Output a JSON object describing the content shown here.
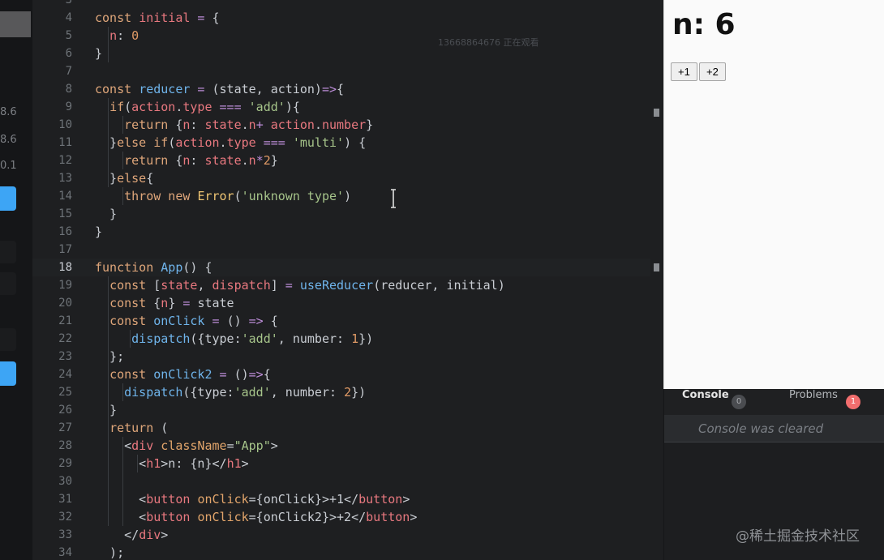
{
  "sidebar": {
    "nums": [
      "8.6",
      "8.6",
      "0.1"
    ]
  },
  "editor": {
    "watermark": "13668864676 正在观看",
    "lines": [
      {
        "n": "3",
        "t": []
      },
      {
        "n": "4",
        "t": [
          [
            "kw",
            "const "
          ],
          [
            "var",
            "initial"
          ],
          [
            "op",
            " = "
          ],
          [
            "txt",
            "{"
          ]
        ]
      },
      {
        "n": "5",
        "t": [
          [
            "txt",
            "  "
          ],
          [
            "prop",
            "n"
          ],
          [
            "txt",
            ": "
          ],
          [
            "num",
            "0"
          ]
        ]
      },
      {
        "n": "6",
        "t": [
          [
            "txt",
            "}"
          ]
        ]
      },
      {
        "n": "7",
        "t": []
      },
      {
        "n": "8",
        "t": [
          [
            "kw",
            "const "
          ],
          [
            "fn",
            "reducer"
          ],
          [
            "op",
            " = "
          ],
          [
            "txt",
            "(state, action)"
          ],
          [
            "op",
            "=>"
          ],
          [
            "txt",
            "{"
          ]
        ]
      },
      {
        "n": "9",
        "t": [
          [
            "txt",
            "  "
          ],
          [
            "kw",
            "if"
          ],
          [
            "txt",
            "("
          ],
          [
            "var",
            "action"
          ],
          [
            "txt",
            "."
          ],
          [
            "prop",
            "type"
          ],
          [
            "op",
            " === "
          ],
          [
            "str",
            "'add'"
          ],
          [
            "txt",
            "){"
          ]
        ]
      },
      {
        "n": "10",
        "t": [
          [
            "txt",
            "    "
          ],
          [
            "kw",
            "return "
          ],
          [
            "txt",
            "{"
          ],
          [
            "prop",
            "n"
          ],
          [
            "txt",
            ": "
          ],
          [
            "var",
            "state"
          ],
          [
            "txt",
            "."
          ],
          [
            "prop",
            "n"
          ],
          [
            "op",
            "+ "
          ],
          [
            "var",
            "action"
          ],
          [
            "txt",
            "."
          ],
          [
            "prop",
            "number"
          ],
          [
            "txt",
            "}"
          ]
        ]
      },
      {
        "n": "11",
        "t": [
          [
            "txt",
            "  }"
          ],
          [
            "kw",
            "else if"
          ],
          [
            "txt",
            "("
          ],
          [
            "var",
            "action"
          ],
          [
            "txt",
            "."
          ],
          [
            "prop",
            "type"
          ],
          [
            "op",
            " === "
          ],
          [
            "str",
            "'multi'"
          ],
          [
            "txt",
            ") {"
          ]
        ]
      },
      {
        "n": "12",
        "t": [
          [
            "txt",
            "    "
          ],
          [
            "kw",
            "return "
          ],
          [
            "txt",
            "{"
          ],
          [
            "prop",
            "n"
          ],
          [
            "txt",
            ": "
          ],
          [
            "var",
            "state"
          ],
          [
            "txt",
            "."
          ],
          [
            "prop",
            "n"
          ],
          [
            "op",
            "*"
          ],
          [
            "num",
            "2"
          ],
          [
            "txt",
            "}"
          ]
        ]
      },
      {
        "n": "13",
        "t": [
          [
            "txt",
            "  }"
          ],
          [
            "kw",
            "else"
          ],
          [
            "txt",
            "{"
          ]
        ]
      },
      {
        "n": "14",
        "t": [
          [
            "txt",
            "    "
          ],
          [
            "kw",
            "throw new "
          ],
          [
            "cls",
            "Error"
          ],
          [
            "txt",
            "("
          ],
          [
            "str",
            "'unknown type'"
          ],
          [
            "txt",
            ")"
          ]
        ]
      },
      {
        "n": "15",
        "t": [
          [
            "txt",
            "  }"
          ]
        ]
      },
      {
        "n": "16",
        "t": [
          [
            "txt",
            "}"
          ]
        ]
      },
      {
        "n": "17",
        "t": []
      },
      {
        "n": "18",
        "t": [
          [
            "kw",
            "function "
          ],
          [
            "fn",
            "App"
          ],
          [
            "txt",
            "() {"
          ]
        ],
        "active": true
      },
      {
        "n": "19",
        "t": [
          [
            "txt",
            "  "
          ],
          [
            "kw",
            "const "
          ],
          [
            "txt",
            "["
          ],
          [
            "var",
            "state"
          ],
          [
            "txt",
            ", "
          ],
          [
            "var",
            "dispatch"
          ],
          [
            "txt",
            "]"
          ],
          [
            "op",
            " = "
          ],
          [
            "fn",
            "useReducer"
          ],
          [
            "txt",
            "(reducer, initial)"
          ]
        ]
      },
      {
        "n": "20",
        "t": [
          [
            "txt",
            "  "
          ],
          [
            "kw",
            "const "
          ],
          [
            "txt",
            "{"
          ],
          [
            "var",
            "n"
          ],
          [
            "txt",
            "}"
          ],
          [
            "op",
            " = "
          ],
          [
            "txt",
            "state"
          ]
        ]
      },
      {
        "n": "21",
        "t": [
          [
            "txt",
            "  "
          ],
          [
            "kw",
            "const "
          ],
          [
            "fn",
            "onClick"
          ],
          [
            "op",
            " = "
          ],
          [
            "txt",
            "() "
          ],
          [
            "op",
            "=>"
          ],
          [
            "txt",
            " {"
          ]
        ]
      },
      {
        "n": "22",
        "t": [
          [
            "txt",
            "     "
          ],
          [
            "fn",
            "dispatch"
          ],
          [
            "txt",
            "({type:"
          ],
          [
            "str",
            "'add'"
          ],
          [
            "txt",
            ", number: "
          ],
          [
            "num",
            "1"
          ],
          [
            "txt",
            "})"
          ]
        ]
      },
      {
        "n": "23",
        "t": [
          [
            "txt",
            "  };"
          ]
        ]
      },
      {
        "n": "24",
        "t": [
          [
            "txt",
            "  "
          ],
          [
            "kw",
            "const "
          ],
          [
            "fn",
            "onClick2"
          ],
          [
            "op",
            " = "
          ],
          [
            "txt",
            "()"
          ],
          [
            "op",
            "=>"
          ],
          [
            "txt",
            "{"
          ]
        ]
      },
      {
        "n": "25",
        "t": [
          [
            "txt",
            "    "
          ],
          [
            "fn",
            "dispatch"
          ],
          [
            "txt",
            "({type:"
          ],
          [
            "str",
            "'add'"
          ],
          [
            "txt",
            ", number: "
          ],
          [
            "num",
            "2"
          ],
          [
            "txt",
            "})"
          ]
        ]
      },
      {
        "n": "26",
        "t": [
          [
            "txt",
            "  }"
          ]
        ]
      },
      {
        "n": "27",
        "t": [
          [
            "txt",
            "  "
          ],
          [
            "kw",
            "return "
          ],
          [
            "txt",
            "("
          ]
        ]
      },
      {
        "n": "28",
        "t": [
          [
            "txt",
            "    <"
          ],
          [
            "tag",
            "div "
          ],
          [
            "attr",
            "className"
          ],
          [
            "txt",
            "="
          ],
          [
            "str",
            "\"App\""
          ],
          [
            "txt",
            ">"
          ]
        ]
      },
      {
        "n": "29",
        "t": [
          [
            "txt",
            "      <"
          ],
          [
            "tag",
            "h1"
          ],
          [
            "txt",
            ">n: {n}</"
          ],
          [
            "tag",
            "h1"
          ],
          [
            "txt",
            ">"
          ]
        ]
      },
      {
        "n": "30",
        "t": []
      },
      {
        "n": "31",
        "t": [
          [
            "txt",
            "      <"
          ],
          [
            "tag",
            "button "
          ],
          [
            "attr",
            "onClick"
          ],
          [
            "txt",
            "={onClick}>+1</"
          ],
          [
            "tag",
            "button"
          ],
          [
            "txt",
            ">"
          ]
        ]
      },
      {
        "n": "32",
        "t": [
          [
            "txt",
            "      <"
          ],
          [
            "tag",
            "button "
          ],
          [
            "attr",
            "onClick"
          ],
          [
            "txt",
            "={onClick2}>+2</"
          ],
          [
            "tag",
            "button"
          ],
          [
            "txt",
            ">"
          ]
        ]
      },
      {
        "n": "33",
        "t": [
          [
            "txt",
            "    </"
          ],
          [
            "tag",
            "div"
          ],
          [
            "txt",
            ">"
          ]
        ]
      },
      {
        "n": "34",
        "t": [
          [
            "txt",
            "  );"
          ]
        ]
      }
    ]
  },
  "preview": {
    "heading": "n: 6",
    "button1": "+1",
    "button2": "+2"
  },
  "console": {
    "tab_console": "Console",
    "console_count": "0",
    "tab_problems": "Problems",
    "problems_count": "1",
    "status": "Console was cleared"
  },
  "credit": "@稀土掘金技术社区",
  "colors": {
    "accent": "#3da5f5",
    "problems_badge": "#f26e6e",
    "console_badge": "#4a4c50"
  }
}
